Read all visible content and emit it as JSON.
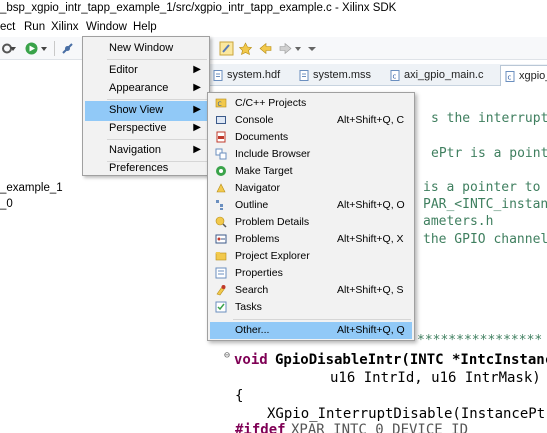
{
  "window": {
    "title": "_bsp_xgpio_intr_tapp_example_1/src/xgpio_intr_tapp_example.c - Xilinx SDK"
  },
  "menubar": {
    "items": [
      "ect",
      "Run",
      "Xilinx",
      "Window",
      "Help"
    ]
  },
  "left_pane": {
    "items": [
      "_example_1",
      "_0"
    ]
  },
  "editor_tabs": [
    {
      "label": "system.hdf"
    },
    {
      "label": "system.mss"
    },
    {
      "label": "axi_gpio_main.c"
    },
    {
      "label": "xgpio_i"
    }
  ],
  "code_lines": [
    "s the interrupts",
    "ePtr is a pointer",
    "is a pointer to",
    "PAR_<INTC_instanc",
    "ameters.h",
    "the GPIO channel",
    "****************",
    "GpioDisableIntr(INTC *IntcInstanceP",
    "u16 IntrId, u16 IntrMask)",
    "{",
    "XGpio_InterruptDisable(InstancePtr,",
    "XPAR_INTC_0_DEVICE_ID"
  ],
  "code_tokens": {
    "void": "void",
    "ifdef": "#ifdef"
  },
  "window_menu": {
    "items": [
      {
        "label": "New Window",
        "submenu": false
      },
      {
        "label": "Editor",
        "submenu": true
      },
      {
        "label": "Appearance",
        "submenu": true
      },
      {
        "label": "Show View",
        "submenu": true,
        "selected": true
      },
      {
        "label": "Perspective",
        "submenu": true
      },
      {
        "label": "Navigation",
        "submenu": true
      },
      {
        "label": "Preferences",
        "submenu": false
      }
    ]
  },
  "show_view_menu": {
    "items": [
      {
        "label": "C/C++ Projects",
        "shortcut": "",
        "icon": "cpp-projects-icon"
      },
      {
        "label": "Console",
        "shortcut": "Alt+Shift+Q, C",
        "icon": "console-icon"
      },
      {
        "label": "Documents",
        "shortcut": "",
        "icon": "documents-icon"
      },
      {
        "label": "Include Browser",
        "shortcut": "",
        "icon": "include-browser-icon"
      },
      {
        "label": "Make Target",
        "shortcut": "",
        "icon": "make-target-icon"
      },
      {
        "label": "Navigator",
        "shortcut": "",
        "icon": "navigator-icon"
      },
      {
        "label": "Outline",
        "shortcut": "Alt+Shift+Q, O",
        "icon": "outline-icon"
      },
      {
        "label": "Problem Details",
        "shortcut": "",
        "icon": "problem-details-icon"
      },
      {
        "label": "Problems",
        "shortcut": "Alt+Shift+Q, X",
        "icon": "problems-icon"
      },
      {
        "label": "Project Explorer",
        "shortcut": "",
        "icon": "project-explorer-icon"
      },
      {
        "label": "Properties",
        "shortcut": "",
        "icon": "properties-icon"
      },
      {
        "label": "Search",
        "shortcut": "Alt+Shift+Q, S",
        "icon": "search-icon"
      },
      {
        "label": "Tasks",
        "shortcut": "",
        "icon": "tasks-icon"
      },
      {
        "label": "Other...",
        "shortcut": "Alt+Shift+Q, Q",
        "icon": "",
        "selected": true
      }
    ]
  },
  "colors": {
    "selection": "#91c9f7",
    "menu_bg": "#f2f2f2",
    "comment": "#3f7f5f",
    "keyword": "#7f0055"
  }
}
